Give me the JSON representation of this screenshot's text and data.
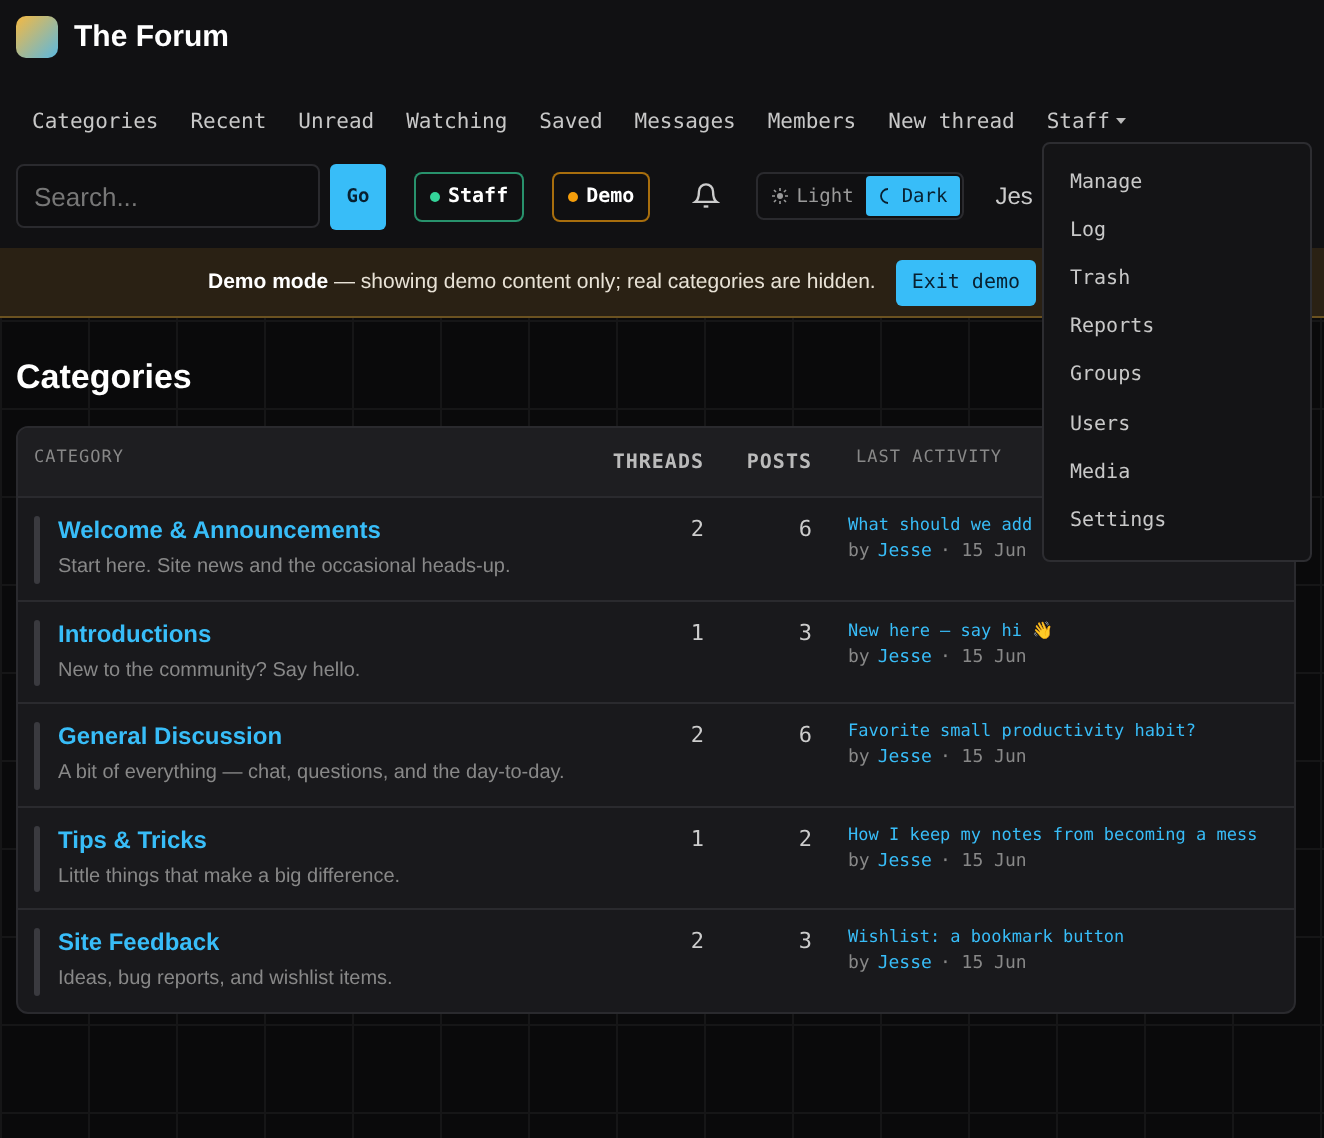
{
  "brand": {
    "title": "The Forum"
  },
  "nav": [
    {
      "label": "Categories",
      "kind": "link"
    },
    {
      "label": "Recent",
      "kind": "link"
    },
    {
      "label": "Unread",
      "kind": "link"
    },
    {
      "label": "Watching",
      "kind": "link"
    },
    {
      "label": "Saved",
      "kind": "link"
    },
    {
      "label": "Messages",
      "kind": "link"
    },
    {
      "label": "Members",
      "kind": "link"
    },
    {
      "label": "New thread",
      "kind": "link"
    },
    {
      "label": "Staff",
      "kind": "menu"
    }
  ],
  "toolbar": {
    "search": {
      "placeholder": "Search..."
    },
    "go": "Go",
    "badges": [
      {
        "label": "Staff",
        "color": "#34d399"
      },
      {
        "label": "Demo",
        "color": "#f59e0b"
      }
    ],
    "theme": [
      {
        "label": "Light",
        "selected": false
      },
      {
        "label": "Dark",
        "selected": true
      }
    ],
    "user": "Jes"
  },
  "banner": {
    "text": "**Demo mode** — showing demo content only; real categories are hidden.",
    "button": "Exit demo"
  },
  "staff_menu": {
    "items": [
      "Manage",
      "Log",
      "Trash",
      "Reports",
      "Groups",
      "Users",
      "Media",
      "Settings"
    ]
  },
  "heading": "Categories",
  "table": {
    "columns": [
      "CATEGORY",
      "THREADS",
      "POSTS",
      "LAST ACTIVITY"
    ],
    "rows": [
      {
        "name": "Welcome & Announcements",
        "description": "Start here. Site news and the occasional heads-up.",
        "threads": "2",
        "posts": "6",
        "last_title": "What should we add",
        "by": "by",
        "author": "Jesse",
        "date": "· 15 Jun"
      },
      {
        "name": "Introductions",
        "description": "New to the community? Say hello.",
        "threads": "1",
        "posts": "3",
        "last_title": "New here — say hi 👋",
        "by": "by",
        "author": "Jesse",
        "date": "· 15 Jun"
      },
      {
        "name": "General Discussion",
        "description": "A bit of everything — chat, questions, and the day-to-day.",
        "threads": "2",
        "posts": "6",
        "last_title": "Favorite small productivity habit?",
        "by": "by",
        "author": "Jesse",
        "date": "· 15 Jun"
      },
      {
        "name": "Tips & Tricks",
        "description": "Little things that make a big difference.",
        "threads": "1",
        "posts": "2",
        "last_title": "How I keep my notes from becoming a mess",
        "by": "by",
        "author": "Jesse",
        "date": "· 15 Jun"
      },
      {
        "name": "Site Feedback",
        "description": "Ideas, bug reports, and wishlist items.",
        "threads": "2",
        "posts": "3",
        "last_title": "Wishlist: a bookmark button",
        "by": "by",
        "author": "Jesse",
        "date": "· 15 Jun"
      }
    ]
  }
}
